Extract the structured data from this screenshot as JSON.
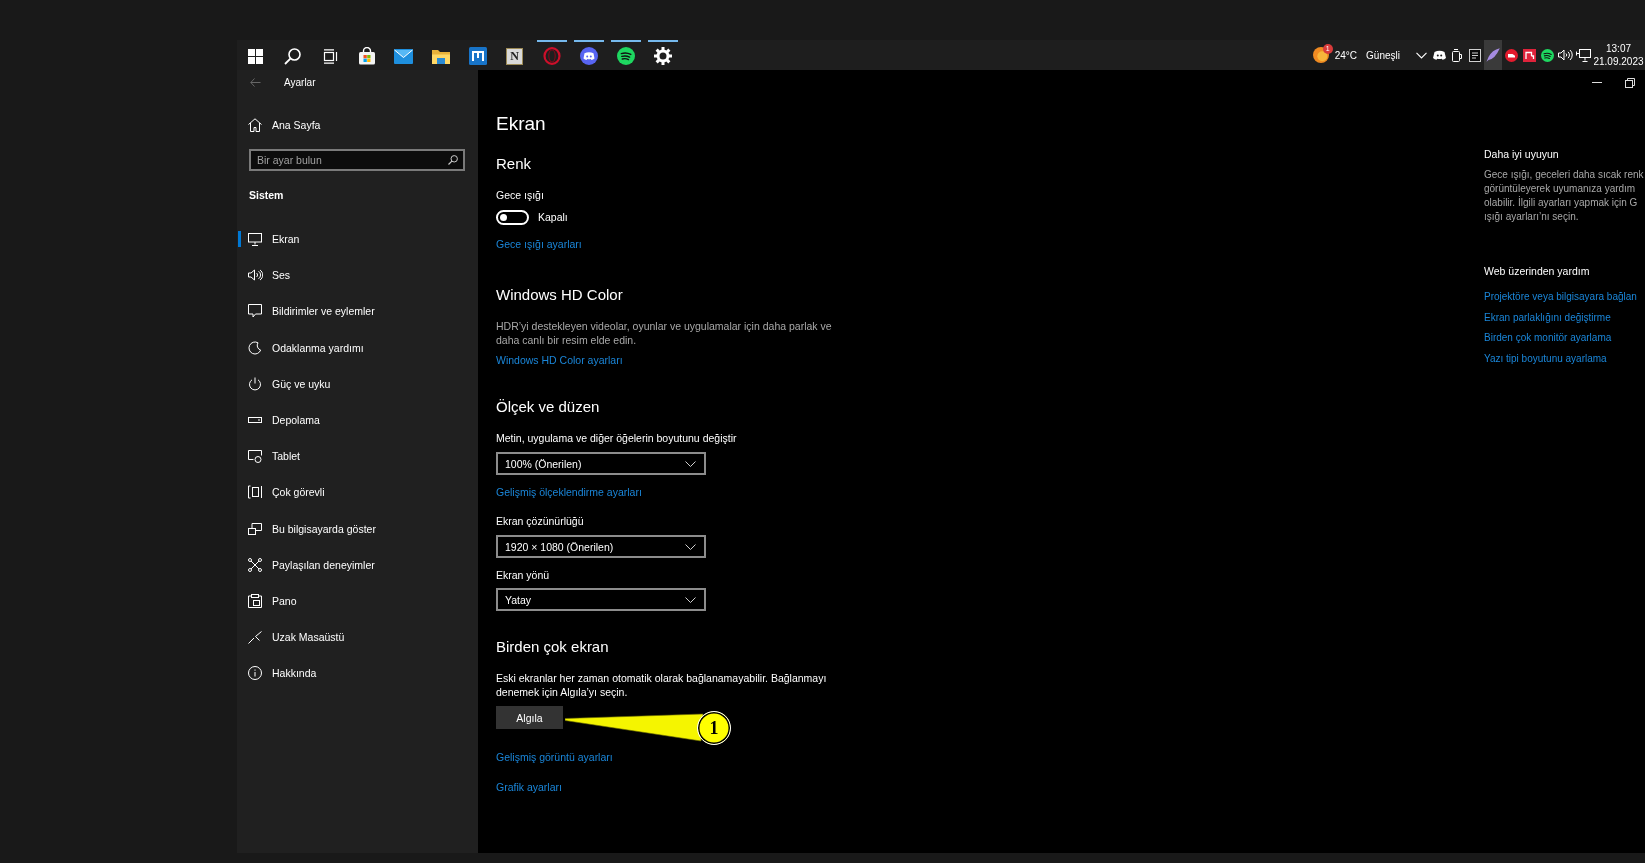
{
  "taskbar": {
    "apps": [
      {
        "kind": "start",
        "running": false
      },
      {
        "kind": "search",
        "running": false
      },
      {
        "kind": "task-view",
        "running": false
      },
      {
        "kind": "store",
        "running": false
      },
      {
        "kind": "mail",
        "running": false
      },
      {
        "kind": "explorer",
        "running": false
      },
      {
        "kind": "tile",
        "running": false
      },
      {
        "kind": "letter-tile",
        "glyph": "N",
        "running": false
      },
      {
        "kind": "ring",
        "running": true
      },
      {
        "kind": "chat",
        "running": true
      },
      {
        "kind": "music",
        "running": true
      },
      {
        "kind": "settings",
        "running": true
      }
    ],
    "weather": {
      "badge": "1",
      "temperature": "24°C",
      "condition": "Güneşli"
    },
    "tray_icons": [
      {
        "kind": "overflow",
        "highlighted": false
      },
      {
        "kind": "chat",
        "highlighted": false
      },
      {
        "kind": "device",
        "highlighted": false
      },
      {
        "kind": "launcher",
        "highlighted": false
      },
      {
        "kind": "feather",
        "highlighted": true
      },
      {
        "kind": "disc",
        "highlighted": false
      },
      {
        "kind": "square",
        "highlighted": false
      },
      {
        "kind": "music",
        "highlighted": false
      },
      {
        "kind": "volume",
        "highlighted": false
      },
      {
        "kind": "network",
        "highlighted": false
      }
    ],
    "clock": {
      "time": "13:07",
      "date": "21.09.2023"
    }
  },
  "window": {
    "title": "Ayarlar",
    "back": {
      "disabled": true
    }
  },
  "sidebar": {
    "home": "Ana Sayfa",
    "search": {
      "placeholder": "Bir ayar bulun"
    },
    "section": "Sistem",
    "items": [
      {
        "label": "Ekran",
        "kind": "display",
        "selected": true
      },
      {
        "label": "Ses",
        "kind": "sound",
        "selected": false
      },
      {
        "label": "Bildirimler ve eylemler",
        "kind": "notifications",
        "selected": false
      },
      {
        "label": "Odaklanma yardımı",
        "kind": "focus",
        "selected": false
      },
      {
        "label": "Güç ve uyku",
        "kind": "power",
        "selected": false
      },
      {
        "label": "Depolama",
        "kind": "storage",
        "selected": false
      },
      {
        "label": "Tablet",
        "kind": "tablet",
        "selected": false
      },
      {
        "label": "Çok görevli",
        "kind": "multitasking",
        "selected": false
      },
      {
        "label": "Bu bilgisayarda göster",
        "kind": "projecting",
        "selected": false
      },
      {
        "label": "Paylaşılan deneyimler",
        "kind": "shared",
        "selected": false
      },
      {
        "label": "Pano",
        "kind": "clipboard",
        "selected": false
      },
      {
        "label": "Uzak Masaüstü",
        "kind": "remote",
        "selected": false
      },
      {
        "label": "Hakkında",
        "kind": "about",
        "selected": false
      }
    ]
  },
  "page": {
    "title": "Ekran",
    "color": {
      "heading": "Renk",
      "night_light": {
        "label": "Gece ışığı",
        "on": false,
        "state": "Kapalı"
      },
      "link": "Gece ışığı ayarları"
    },
    "hd_color": {
      "heading": "Windows HD Color",
      "description": "HDR’yi destekleyen videolar, oyunlar ve uygulamalar için daha parlak ve daha canlı bir resim elde edin.",
      "link": "Windows HD Color ayarları"
    },
    "scale_layout": {
      "heading": "Ölçek ve düzen",
      "size": {
        "label": "Metin, uygulama ve diğer öğelerin boyutunu değiştir",
        "value": "100% (Önerilen)"
      },
      "advanced_link": "Gelişmiş ölçeklendirme ayarları",
      "resolution": {
        "label": "Ekran çözünürlüğü",
        "value": "1920 × 1080 (Önerilen)"
      },
      "orientation": {
        "label": "Ekran yönü",
        "value": "Yatay"
      }
    },
    "multiple_displays": {
      "heading": "Birden çok ekran",
      "description": "Eski ekranlar her zaman otomatik olarak bağlanamayabilir. Bağlanmayı denemek için Algıla’yı seçin.",
      "button": "Algıla",
      "links": [
        "Gelişmiş görüntü ayarları",
        "Grafik ayarları"
      ]
    }
  },
  "help_panel": {
    "heading": "Daha iyi uyuyun",
    "lines": [
      "Gece ışığı, geceleri daha sıcak renk",
      "görüntüleyerek uyumanıza yardım",
      "olabilir. İlgili ayarları yapmak için G",
      "ışığı ayarları’nı seçin."
    ],
    "web_heading": "Web üzerinden yardım",
    "links": [
      "Projektöre veya bilgisayara bağlan",
      "Ekran parlaklığını değiştirme",
      "Birden çok monitör ayarlama",
      "Yazı tipi boyutunu ayarlama"
    ]
  },
  "callout": {
    "label": "1"
  }
}
